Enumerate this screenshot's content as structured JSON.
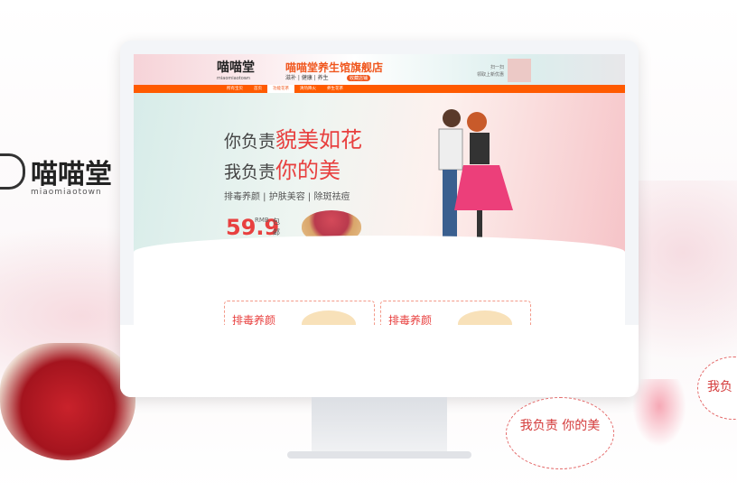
{
  "brand": {
    "name": "喵喵堂",
    "subtitle": "miaomiaotown"
  },
  "site": {
    "logo": "喵喵堂",
    "logo_sub": "miaomiaotown",
    "store_name": "喵喵堂养生馆旗舰店",
    "tags": "滋补 | 健康 | 养生",
    "favorite_badge": "收藏店铺",
    "scan_text": "扫一扫",
    "scan_sub": "领取上新优惠",
    "nav": [
      "所有宝贝",
      "首页",
      "功能花茶",
      "清热降火",
      "养生花茶"
    ],
    "nav_active": 2,
    "banner": {
      "line1_a": "你负责",
      "line1_b": "貌美如花",
      "line2_a": "我负责",
      "line2_b": "你的美",
      "features": "排毒养颜 | 护肤美容 | 除斑祛痘",
      "price": "59.9",
      "currency": "RMB",
      "shipping": "包邮"
    },
    "cards": [
      "排毒养颜",
      "排毒养颜"
    ]
  },
  "decor": {
    "bubble1": "我负责 你的美",
    "bubble2": "我负"
  },
  "colors": {
    "accent": "#ff5a00",
    "red": "#e8403f"
  }
}
